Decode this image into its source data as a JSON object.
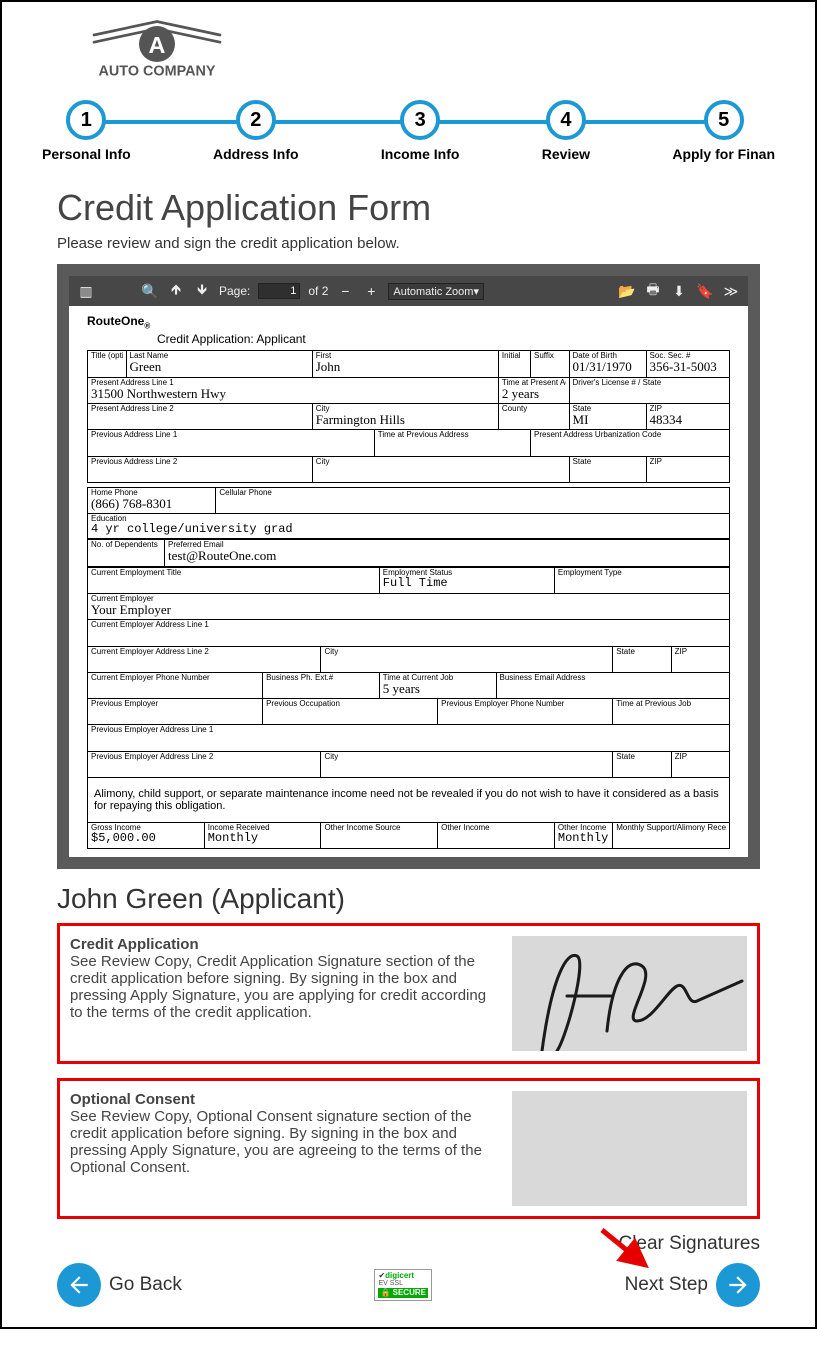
{
  "brand": "AUTO COMPANY",
  "stepper": {
    "steps": [
      {
        "num": "1",
        "label": "Personal Info"
      },
      {
        "num": "2",
        "label": "Address Info"
      },
      {
        "num": "3",
        "label": "Income Info"
      },
      {
        "num": "4",
        "label": "Review"
      },
      {
        "num": "5",
        "label": "Apply for Finan"
      }
    ]
  },
  "page": {
    "title": "Credit Application Form",
    "subtitle": "Please review and sign the credit application below."
  },
  "pdf_toolbar": {
    "page_label": "Page:",
    "page_current": "1",
    "page_total": "of 2",
    "zoom": "Automatic Zoom"
  },
  "doc": {
    "brand": "RouteOne",
    "heading": "Credit Application: Applicant",
    "labels": {
      "title": "Title (optional)",
      "last_name": "Last Name",
      "first": "First",
      "initial": "Initial",
      "suffix": "Suffix",
      "dob": "Date of Birth",
      "ssn": "Soc. Sec. #",
      "addr1": "Present Address Line 1",
      "time_at_addr": "Time at Present Address",
      "dl": "Driver's License # / State",
      "addr2": "Present Address Line 2",
      "city": "City",
      "county": "County",
      "state": "State",
      "zip": "ZIP",
      "prev_addr1": "Previous Address Line 1",
      "time_prev_addr": "Time at Previous Address",
      "urb": "Present Address Urbanization Code",
      "prev_addr2": "Previous Address Line 2",
      "home_phone": "Home Phone",
      "cell_phone": "Cellular Phone",
      "education": "Education",
      "dependents": "No. of Dependents",
      "pref_email": "Preferred Email",
      "cur_emp_title": "Current Employment Title",
      "emp_status": "Employment Status",
      "emp_type": "Employment Type",
      "cur_employer": "Current Employer",
      "cur_emp_addr1": "Current Employer Address Line 1",
      "cur_emp_addr2": "Current Employer Address Line 2",
      "cur_emp_phone": "Current Employer Phone Number",
      "bus_ph_ext": "Business Ph. Ext.#",
      "time_cur_job": "Time at Current Job",
      "bus_email": "Business Email Address",
      "prev_employer": "Previous Employer",
      "prev_occupation": "Previous Occupation",
      "prev_emp_phone": "Previous Employer Phone Number",
      "time_prev_job": "Time at Previous Job",
      "prev_emp_addr1": "Previous Employer Address Line 1",
      "prev_emp_addr2": "Previous Employer Address Line 2",
      "gross_income": "Gross Income",
      "income_received": "Income Received",
      "other_income_src": "Other Income Source",
      "other_income": "Other Income",
      "other_income_recv": "Other Income Received",
      "monthly_support": "Monthly Support/Alimony Received"
    },
    "values": {
      "last_name": "Green",
      "first": "John",
      "dob": "01/31/1970",
      "ssn": "356-31-5003",
      "addr1": "31500 Northwestern Hwy",
      "time_at_addr": "2 years",
      "city": "Farmington Hills",
      "state": "MI",
      "zip": "48334",
      "home_phone": "(866) 768-8301",
      "education": "4 yr college/university grad",
      "pref_email": "test@RouteOne.com",
      "emp_status": "Full Time",
      "cur_employer": "Your Employer",
      "time_cur_job": "5 years",
      "gross_income": "$5,000.00",
      "income_received": "Monthly",
      "other_income_recv": "Monthly"
    },
    "note": "Alimony, child support, or separate maintenance income need not be revealed if you do not wish to have it considered as a basis for repaying this obligation."
  },
  "signature": {
    "applicant": "John Green (Applicant)",
    "blocks": [
      {
        "title": "Credit Application",
        "body": "See Review Copy, Credit Application Signature section of the credit application before signing. By signing in the box and pressing Apply Signature, you are applying for credit according to the terms of the credit application."
      },
      {
        "title": "Optional Consent",
        "body": "See Review Copy, Optional Consent signature section of the credit application before signing. By signing in the box and pressing Apply Signature, you are agreeing to the terms of the Optional Consent."
      }
    ],
    "clear": "Clear Signatures"
  },
  "nav": {
    "back": "Go Back",
    "next": "Next Step"
  },
  "secure_badge": {
    "brand": "digicert",
    "line2": "EV SSL",
    "line3": "🔒 SECURE"
  }
}
